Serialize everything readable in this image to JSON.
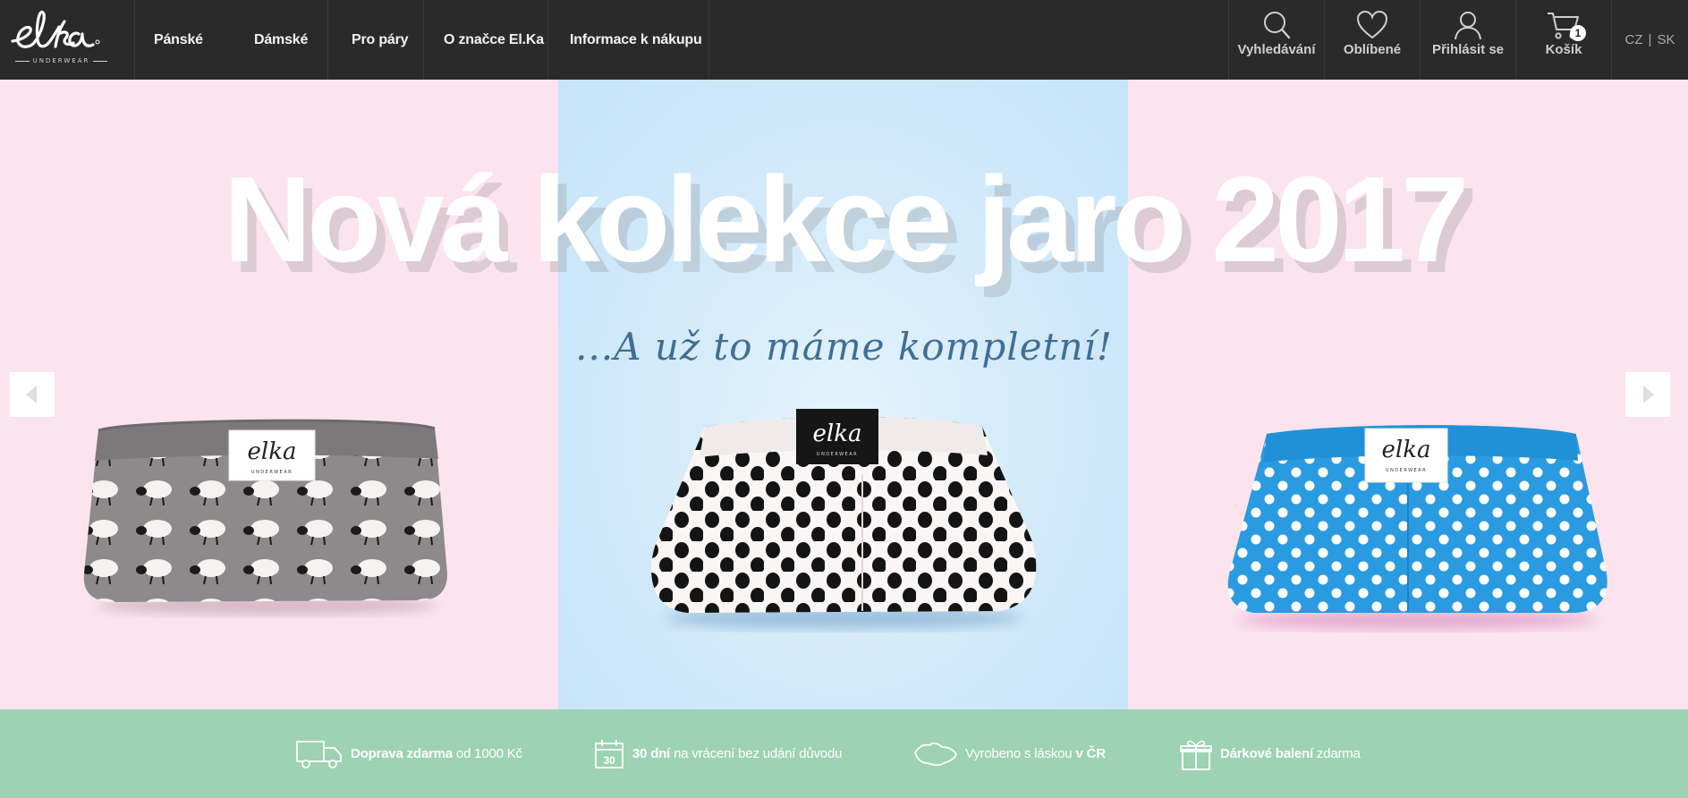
{
  "brand": {
    "name": "elka",
    "tagline": "UNDERWEAR"
  },
  "nav": {
    "items": [
      {
        "label": "Pánské"
      },
      {
        "label": "Dámské"
      },
      {
        "label": "Pro páry"
      },
      {
        "label": "O značce El.Ka"
      },
      {
        "label": "Informace k nákupu"
      }
    ]
  },
  "tools": {
    "search": {
      "label": "Vyhledávání",
      "icon": "search-icon"
    },
    "favorites": {
      "label": "Oblíbené",
      "icon": "heart-icon"
    },
    "login": {
      "label": "Přihlásit se",
      "icon": "user-icon"
    },
    "cart": {
      "label": "Košík",
      "icon": "cart-icon",
      "count": "1"
    }
  },
  "lang": {
    "cz": "CZ",
    "separator": "|",
    "sk": "SK"
  },
  "hero": {
    "title": "Nová kolekce jaro 2017",
    "subtitle": "...A už to máme kompletní!",
    "products": [
      {
        "pattern": "sheep",
        "label": "elka"
      },
      {
        "pattern": "black-polka-dots",
        "label": "elka"
      },
      {
        "pattern": "blue-polka-dots",
        "label": "elka"
      }
    ],
    "colors": {
      "pink": "#fbe4ee",
      "blue": "#cfe8fa"
    }
  },
  "benefits": {
    "shipping": {
      "bold": "Doprava zdarma",
      "text": "od 1000 Kč",
      "icon": "truck-icon"
    },
    "returns": {
      "bold": "30 dní",
      "text": "na vrácení bez udání důvodu",
      "icon": "calendar-icon",
      "icon_text": "30"
    },
    "made": {
      "text": "Vyrobeno s láskou",
      "bold": "v ČR",
      "icon": "map-cz-icon"
    },
    "gift": {
      "bold": "Dárkové balení",
      "text": "zdarma",
      "icon": "gift-icon"
    },
    "bar_color": "#9dd2b2"
  }
}
